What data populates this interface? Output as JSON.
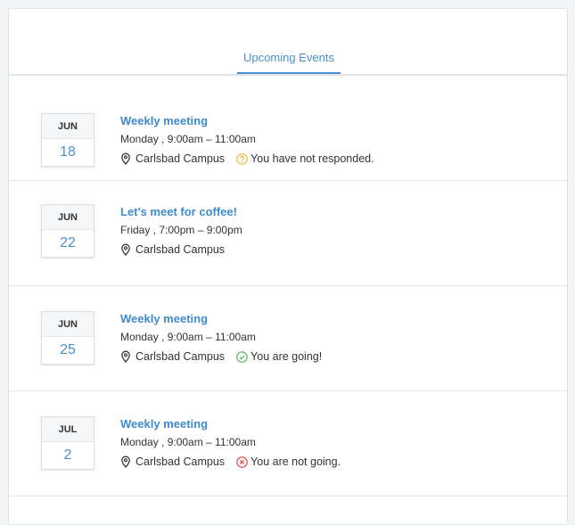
{
  "tabs": [
    {
      "label": "Upcoming Events"
    }
  ],
  "events": [
    {
      "month": "JUN",
      "day": "18",
      "title": "Weekly meeting",
      "time": "Monday ,  9:00am – 11:00am",
      "location": "Carlsbad Campus",
      "status": "You have not responded.",
      "status_icon": "question-icon",
      "status_color": "#f0b429"
    },
    {
      "month": "JUN",
      "day": "22",
      "title": "Let's meet for coffee!",
      "time": "Friday ,  7:00pm – 9:00pm",
      "location": "Carlsbad Campus",
      "status": "",
      "status_icon": "",
      "status_color": ""
    },
    {
      "month": "JUN",
      "day": "25",
      "title": "Weekly meeting",
      "time": "Monday ,  9:00am – 11:00am",
      "location": "Carlsbad Campus",
      "status": "You are going!",
      "status_icon": "check-circle-icon",
      "status_color": "#4caf50"
    },
    {
      "month": "JUL",
      "day": "2",
      "title": "Weekly meeting",
      "time": "Monday ,  9:00am – 11:00am",
      "location": "Carlsbad Campus",
      "status": "You are not going.",
      "status_icon": "x-circle-icon",
      "status_color": "#e53935"
    }
  ],
  "colors": {
    "accent": "#4a8fcc",
    "going": "#4caf50",
    "not_going": "#e53935",
    "pending": "#f0b429"
  }
}
